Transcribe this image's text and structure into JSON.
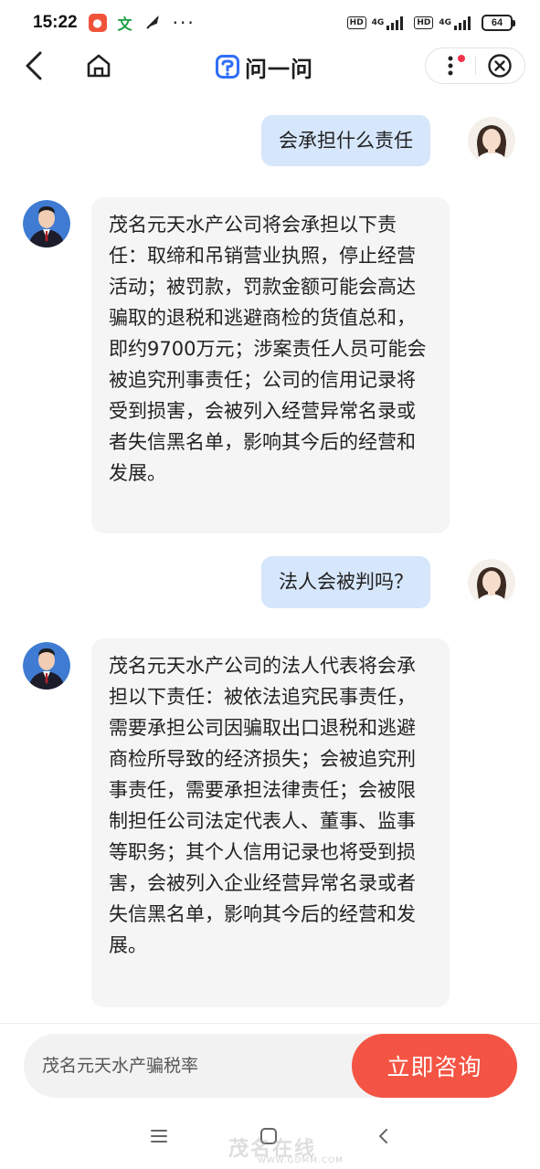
{
  "status_bar": {
    "time": "15:22",
    "app_icons": [
      "red-app-icon",
      "translate-icon",
      "feather-icon"
    ],
    "more": "···",
    "hd1": "HD",
    "net1": "4G",
    "hd2": "HD",
    "net2": "4G",
    "battery": "64"
  },
  "header": {
    "title": "问一问",
    "back_icon": "chevron-left-icon",
    "home_icon": "home-icon",
    "more_icon": "more-vertical-icon",
    "close_icon": "close-circle-icon",
    "brand_color": "#2f6ef7"
  },
  "chat": {
    "messages": [
      {
        "sender": "user",
        "text": "会承担什么责任"
      },
      {
        "sender": "lawyer",
        "text": "茂名元天水产公司将会承担以下责任：取缔和吊销营业执照，停止经营活动；被罚款，罚款金额可能会高达骗取的退税和逃避商检的货值总和，即约9700万元；涉案责任人员可能会被追究刑事责任；公司的信用记录将受到损害，会被列入经营异常名录或者失信黑名单，影响其今后的经营和发展。"
      },
      {
        "sender": "user",
        "text": "法人会被判吗？"
      },
      {
        "sender": "lawyer",
        "text": "茂名元天水产公司的法人代表将会承担以下责任：被依法追究民事责任，需要承担公司因骗取出口退税和逃避商检所导致的经济损失；会被追究刑事责任，需要承担法律责任；会被限制担任公司法定代表人、董事、监事等职务；其个人信用记录也将受到损害，会被列入企业经营异常名录或者失信黑名单，影响其今后的经营和发展。"
      }
    ]
  },
  "input": {
    "text": "茂名元天水产骗税率",
    "button_label": "立即咨询",
    "button_color": "#f45443"
  },
  "nav_bar": {
    "menu_icon": "menu-icon",
    "home_icon": "square-home-icon",
    "back_icon": "back-icon",
    "watermark": "茂名在线",
    "watermark_url": "WWW.GDMM.COM"
  }
}
